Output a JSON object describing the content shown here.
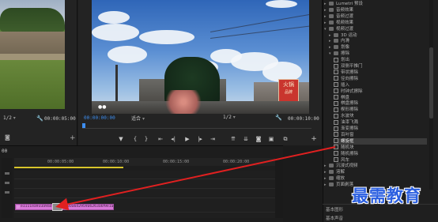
{
  "source_monitor": {
    "zoom": "1/2",
    "timecode": "00:00:05:00"
  },
  "program_monitor": {
    "timecode_current": "00:00:00:00",
    "fit": "适合",
    "zoom": "1/2",
    "timecode_end": "00:00:10:00",
    "sign_text": "火锅",
    "sign_subtext": "品牌"
  },
  "timeline": {
    "timecode": "00",
    "ruler": [
      "00:00:05:00",
      "00:00:10:00",
      "00:00:15:00",
      "00:00:20:00"
    ],
    "clips": [
      {
        "name": "e1111ea933a9a07"
      },
      {
        "name": "30a6d2959a6263a6f9e1ad"
      }
    ],
    "panel_labels": [
      "",
      "",
      ""
    ]
  },
  "effects_panel": {
    "items": [
      {
        "label": "Lumetri 预设",
        "kind": "folder",
        "open": false
      },
      {
        "label": "音频效果",
        "kind": "folder",
        "open": false
      },
      {
        "label": "音频过渡",
        "kind": "folder",
        "open": false
      },
      {
        "label": "视频效果",
        "kind": "folder",
        "open": false
      },
      {
        "label": "视频过渡",
        "kind": "folder",
        "open": true
      },
      {
        "label": "3D 运动",
        "kind": "folder",
        "open": false
      },
      {
        "label": "内滑",
        "kind": "folder",
        "open": false
      },
      {
        "label": "划像",
        "kind": "folder",
        "open": false
      },
      {
        "label": "擦除",
        "kind": "folder",
        "open": true
      },
      {
        "label": "划出",
        "kind": "effect"
      },
      {
        "label": "双侧平推门",
        "kind": "effect"
      },
      {
        "label": "带状擦除",
        "kind": "effect"
      },
      {
        "label": "径向擦除",
        "kind": "effect"
      },
      {
        "label": "插入",
        "kind": "effect"
      },
      {
        "label": "时钟式擦除",
        "kind": "effect"
      },
      {
        "label": "棋盘",
        "kind": "effect"
      },
      {
        "label": "棋盘擦除",
        "kind": "effect"
      },
      {
        "label": "楔形擦除",
        "kind": "effect"
      },
      {
        "label": "水波块",
        "kind": "effect"
      },
      {
        "label": "油漆飞溅",
        "kind": "effect"
      },
      {
        "label": "渐变擦除",
        "kind": "effect"
      },
      {
        "label": "百叶窗",
        "kind": "effect"
      },
      {
        "label": "螺旋框",
        "kind": "effect",
        "selected": true
      },
      {
        "label": "随机块",
        "kind": "effect"
      },
      {
        "label": "随机擦除",
        "kind": "effect"
      },
      {
        "label": "风车",
        "kind": "effect"
      },
      {
        "label": "沉浸式视频",
        "kind": "folder",
        "open": false
      },
      {
        "label": "溶解",
        "kind": "folder",
        "open": false
      },
      {
        "label": "缩放",
        "kind": "folder",
        "open": false
      },
      {
        "label": "页面剥落",
        "kind": "folder",
        "open": false
      }
    ],
    "bottom_labels": [
      "基本图形",
      "基本声音"
    ]
  },
  "watermark": "最需教育",
  "colors": {
    "accent_blue": "#3d8ef0",
    "clip_pink": "#d878d8",
    "arrow_red": "#e02020",
    "watermark_blue": "#2b5fe0"
  }
}
